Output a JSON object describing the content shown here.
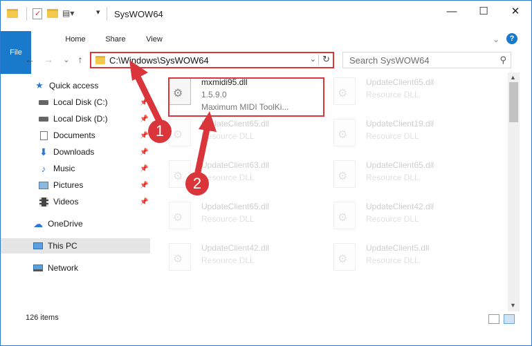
{
  "window": {
    "title": "SysWOW64"
  },
  "titlebar": {
    "minimize": "—",
    "maximize": "☐",
    "close": "✕"
  },
  "ribbon": {
    "tabs": [
      "File",
      "Home",
      "Share",
      "View"
    ],
    "collapse": "⌄",
    "help": "?"
  },
  "nav": {
    "back": "←",
    "forward": "→",
    "recent": "⌄",
    "up": "↑"
  },
  "address": {
    "path": "C:\\Windows\\SysWOW64",
    "dropdown": "⌄",
    "refresh": "↻"
  },
  "search": {
    "placeholder": "Search SysWOW64",
    "icon": "search-icon"
  },
  "sidebar": {
    "items": [
      {
        "label": "Quick access",
        "icon": "star-icon",
        "pinned": false
      },
      {
        "label": "Local Disk (C:)",
        "icon": "drive-icon",
        "pinned": true
      },
      {
        "label": "Local Disk (D:)",
        "icon": "drive-icon",
        "pinned": true
      },
      {
        "label": "Documents",
        "icon": "documents-icon",
        "pinned": true
      },
      {
        "label": "Downloads",
        "icon": "downloads-icon",
        "pinned": true
      },
      {
        "label": "Music",
        "icon": "music-icon",
        "pinned": true
      },
      {
        "label": "Pictures",
        "icon": "pictures-icon",
        "pinned": true
      },
      {
        "label": "Videos",
        "icon": "videos-icon",
        "pinned": true
      },
      {
        "label": "OneDrive",
        "icon": "cloud-icon",
        "pinned": false
      },
      {
        "label": "This PC",
        "icon": "computer-icon",
        "pinned": false
      },
      {
        "label": "Network",
        "icon": "network-icon",
        "pinned": false
      }
    ]
  },
  "files": [
    {
      "name": "mxmidi95.dll",
      "line2": "1.5.9.0",
      "line3": "Maximum MIDI ToolKi...",
      "faded": false
    },
    {
      "name": "UpdateClient65.dll",
      "line2": "Resource DLL",
      "line3": "",
      "faded": true
    },
    {
      "name": "UpdateClient65.dll",
      "line2": "Resource DLL",
      "line3": "",
      "faded": true
    },
    {
      "name": "UpdateClient19.dll",
      "line2": "Resource DLL",
      "line3": "",
      "faded": true
    },
    {
      "name": "UpdateClient63.dll",
      "line2": "Resource DLL",
      "line3": "",
      "faded": true
    },
    {
      "name": "UpdateClient65.dll",
      "line2": "Resource DLL",
      "line3": "",
      "faded": true
    },
    {
      "name": "UpdateClient65.dll",
      "line2": "Resource DLL",
      "line3": "",
      "faded": true
    },
    {
      "name": "UpdateClient42.dll",
      "line2": "Resource DLL",
      "line3": "",
      "faded": true
    },
    {
      "name": "UpdateClient42.dll",
      "line2": "Resource DLL",
      "line3": "",
      "faded": true
    },
    {
      "name": "UpdateClient5.dll",
      "line2": "Resource DLL",
      "line3": "",
      "faded": true
    }
  ],
  "status": {
    "count": "126 items"
  },
  "annotations": {
    "step1": "1",
    "step2": "2",
    "color": "#d9353a"
  },
  "colors": {
    "accent": "#1979ca",
    "highlight": "#d9353a",
    "selected": "#e5e5e5"
  }
}
